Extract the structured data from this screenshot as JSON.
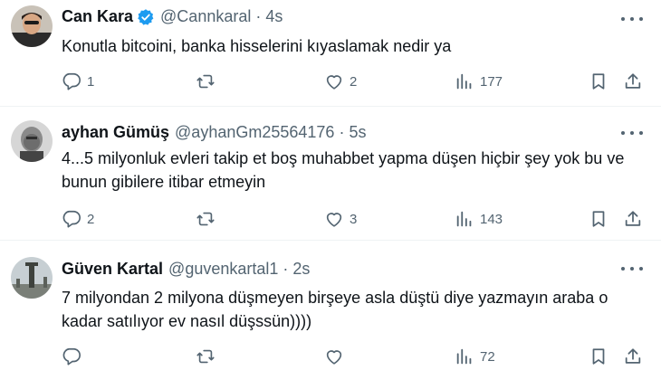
{
  "tweets": [
    {
      "name": "Can Kara",
      "verified": true,
      "handle": "@Cannkaral",
      "time": "4s",
      "text": "Konutla bitcoini, banka hisselerini kıyaslamak nedir ya",
      "replies": "1",
      "retweets": "",
      "likes": "2",
      "views": "177",
      "colors": {
        "verified": "#1d9bf0"
      }
    },
    {
      "name": "ayhan Gümüş",
      "verified": false,
      "handle": "@ayhanGm25564176",
      "time": "5s",
      "text": "4...5 milyonluk evleri takip et boş muhabbet yapma düşen hiçbir şey yok bu ve bunun gibilere itibar etmeyin",
      "replies": "2",
      "retweets": "",
      "likes": "3",
      "views": "143"
    },
    {
      "name": "Güven Kartal",
      "verified": false,
      "handle": "@guvenkartal1",
      "time": "2s",
      "text": "7 milyondan 2 milyona düşmeyen birşeye asla düştü diye yazmayın araba o kadar satılıyor ev nasıl düşssün))))",
      "replies": "",
      "retweets": "",
      "likes": "",
      "views": "72"
    }
  ],
  "separator": "·",
  "icons": [
    "verified-badge-icon",
    "more-icon",
    "reply-icon",
    "retweet-icon",
    "like-icon",
    "views-icon",
    "bookmark-icon",
    "share-icon"
  ]
}
